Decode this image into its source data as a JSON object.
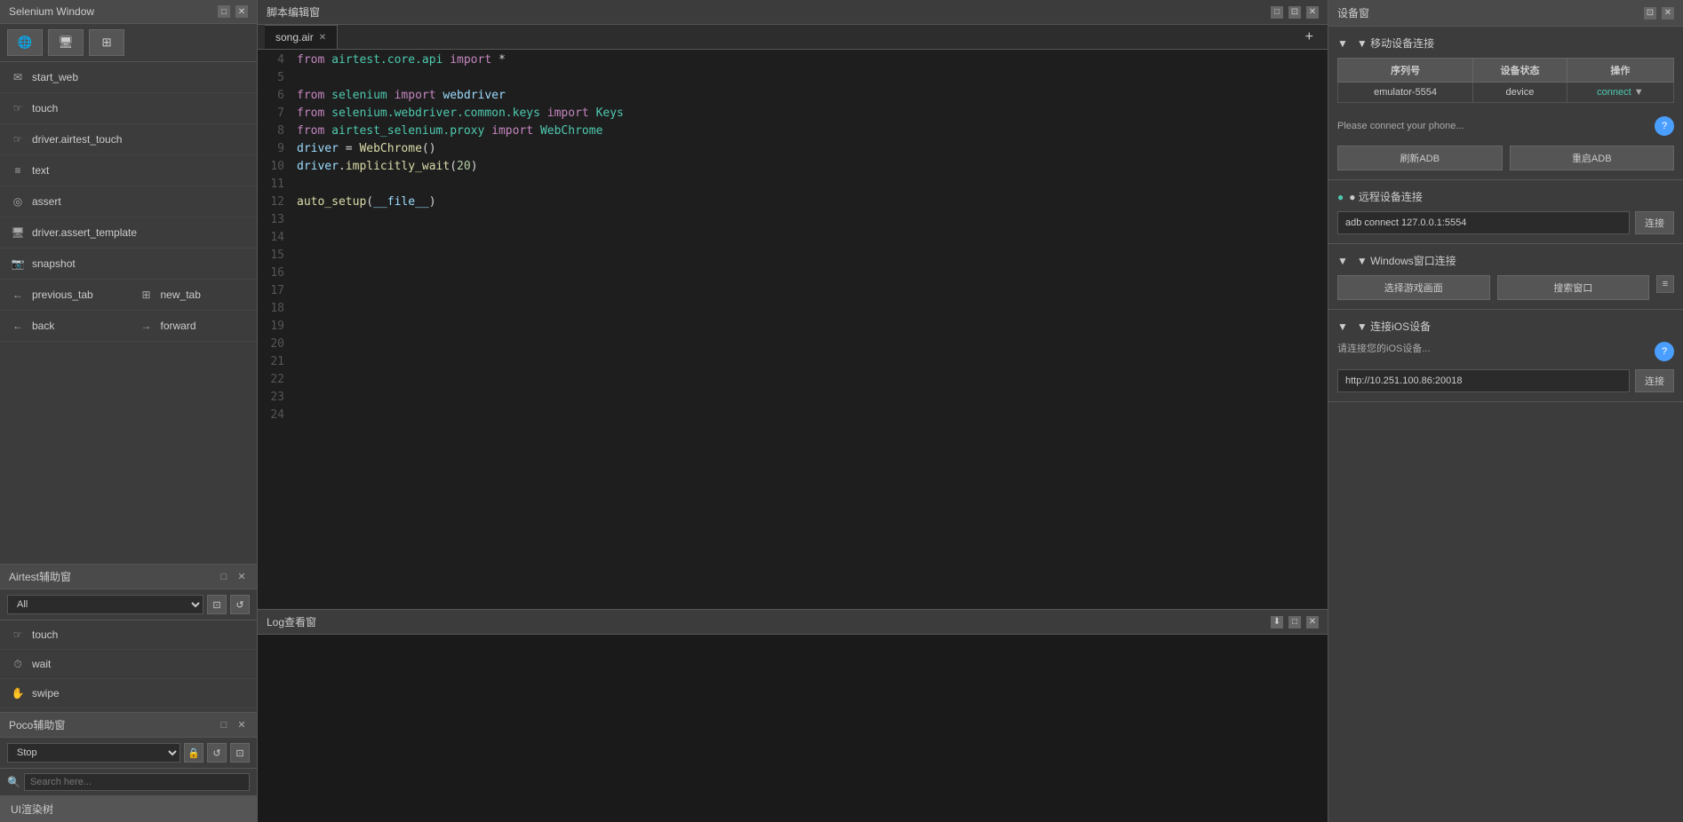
{
  "selenium_window": {
    "title": "Selenium Window",
    "tabs": [
      {
        "icon": "globe",
        "unicode": "🌐"
      },
      {
        "icon": "monitor",
        "unicode": "🖥"
      },
      {
        "icon": "grid",
        "unicode": "⊞"
      }
    ],
    "items": [
      {
        "label": "start_web",
        "icon": "envelope"
      },
      {
        "label": "touch",
        "icon": "cursor"
      },
      {
        "label": "driver.airtest_touch",
        "icon": "cursor"
      },
      {
        "label": "text",
        "icon": "text"
      },
      {
        "label": "assert",
        "icon": "circle"
      },
      {
        "label": "driver.assert_template",
        "icon": "monitor"
      },
      {
        "label": "snapshot",
        "icon": "camera"
      },
      {
        "label": "previous_tab",
        "icon": "arrow-left"
      },
      {
        "label": "new_tab",
        "icon": "plus-square"
      },
      {
        "label": "back",
        "icon": "arrow-left"
      },
      {
        "label": "forward",
        "icon": "arrow-right"
      }
    ]
  },
  "editor": {
    "title": "脚本编辑窗",
    "tab_name": "song.air",
    "add_tab_label": "+",
    "code_lines": [
      {
        "num": 4,
        "content": "from airtest.core.api import *"
      },
      {
        "num": 5,
        "content": ""
      },
      {
        "num": 6,
        "content": "from selenium import webdriver"
      },
      {
        "num": 7,
        "content": "from selenium.webdriver.common.keys import Keys"
      },
      {
        "num": 8,
        "content": "from airtest_selenium.proxy import WebChrome"
      },
      {
        "num": 9,
        "content": "driver = WebChrome()"
      },
      {
        "num": 10,
        "content": "driver.implicitly_wait(20)"
      },
      {
        "num": 11,
        "content": ""
      },
      {
        "num": 12,
        "content": "auto_setup(__file__)"
      },
      {
        "num": 13,
        "content": ""
      },
      {
        "num": 14,
        "content": ""
      },
      {
        "num": 15,
        "content": ""
      },
      {
        "num": 16,
        "content": ""
      },
      {
        "num": 17,
        "content": ""
      },
      {
        "num": 18,
        "content": ""
      },
      {
        "num": 19,
        "content": ""
      },
      {
        "num": 20,
        "content": ""
      },
      {
        "num": 21,
        "content": ""
      },
      {
        "num": 22,
        "content": ""
      },
      {
        "num": 23,
        "content": ""
      },
      {
        "num": 24,
        "content": ""
      }
    ]
  },
  "log_panel": {
    "title": "Log查看窗"
  },
  "device_panel": {
    "title": "设备窗",
    "mobile_section": "▼ 移动设备连接",
    "table_headers": [
      "序列号",
      "设备状态",
      "操作"
    ],
    "devices": [
      {
        "serial": "emulator-5554",
        "status": "device",
        "action": "connect"
      }
    ],
    "connect_hint": "Please connect your phone...",
    "refresh_adb": "刷新ADB",
    "restart_adb": "重启ADB",
    "remote_section": "● 远程设备连接",
    "remote_input_value": "adb connect 127.0.0.1:5554",
    "remote_connect_btn": "连接",
    "windows_section": "▼ Windows窗口连接",
    "select_game": "选择游戏画面",
    "search_window": "搜索窗口",
    "ios_section": "▼ 连接iOS设备",
    "ios_hint": "请连接您的iOS设备...",
    "ios_input_value": "http://10.251.100.86:20018",
    "ios_connect_btn": "连接"
  },
  "airtest_panel": {
    "title": "Airtest辅助窗",
    "select_default": "All",
    "items": [
      {
        "label": "touch",
        "icon": "cursor"
      },
      {
        "label": "wait",
        "icon": "clock"
      },
      {
        "label": "swipe",
        "icon": "hand"
      }
    ]
  },
  "poco_panel": {
    "title": "Poco辅助窗",
    "select_default": "Stop",
    "search_placeholder": "Search here...",
    "tree_item": "UI渲染树"
  }
}
